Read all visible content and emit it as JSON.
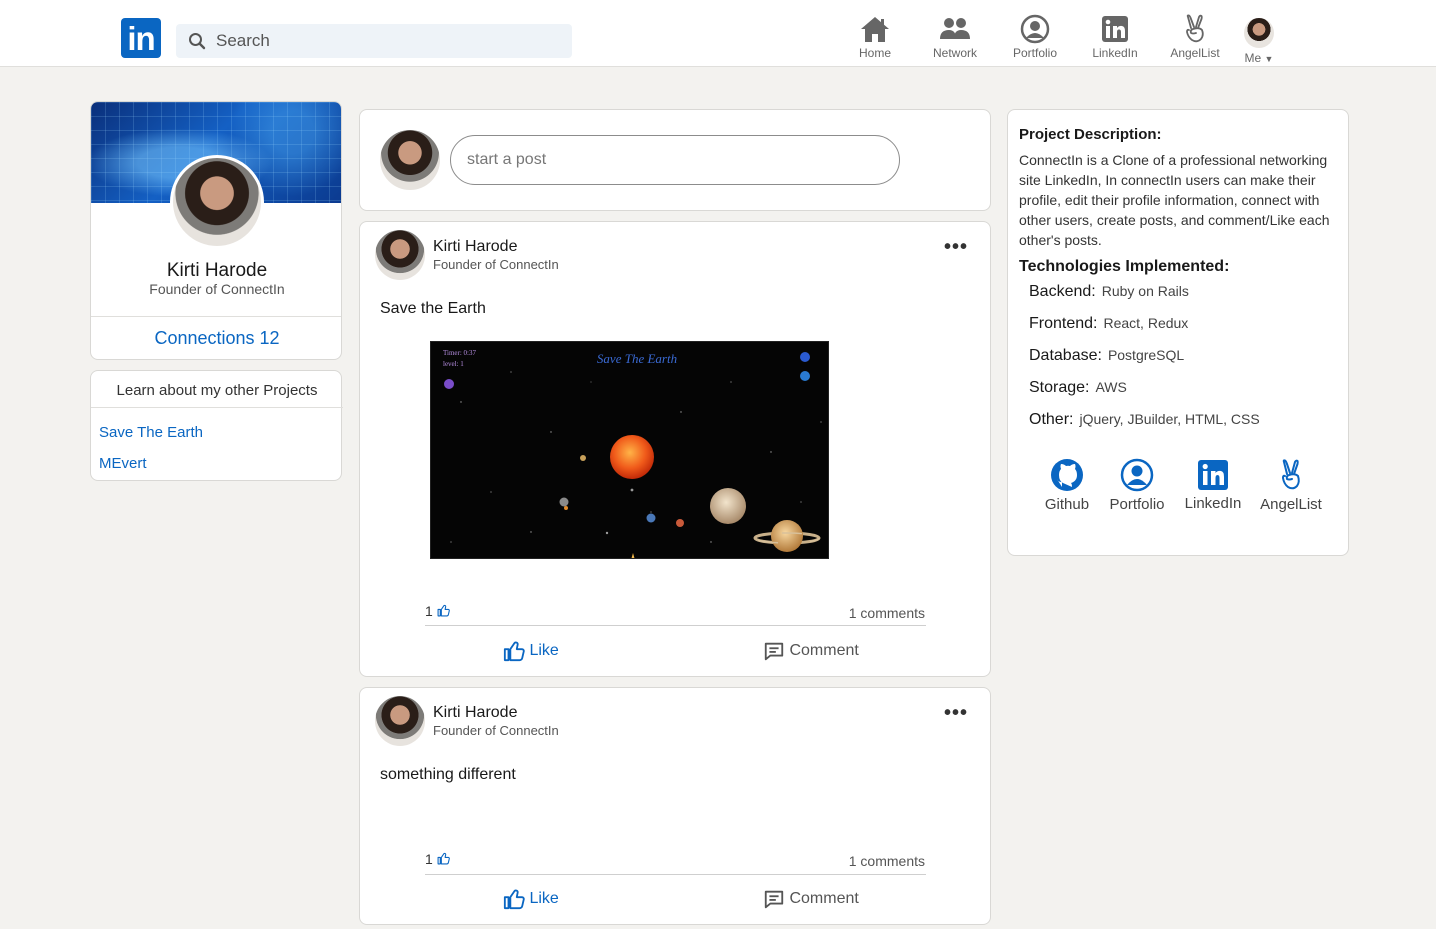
{
  "header": {
    "logo_text": "in",
    "search_placeholder": "Search",
    "nav": [
      {
        "label": "Home",
        "icon": "home-icon"
      },
      {
        "label": "Network",
        "icon": "network-icon"
      },
      {
        "label": "Portfolio",
        "icon": "portfolio-icon"
      },
      {
        "label": "LinkedIn",
        "icon": "linkedin-icon"
      },
      {
        "label": "AngelList",
        "icon": "angellist-icon"
      },
      {
        "label": "Me",
        "icon": "avatar"
      }
    ]
  },
  "profile": {
    "name": "Kirti Harode",
    "title": "Founder of ConnectIn",
    "connections": "Connections 12"
  },
  "projects": {
    "heading": "Learn about my other Projects",
    "links": [
      "Save The Earth",
      "MEvert"
    ]
  },
  "composer": {
    "placeholder": "start a post"
  },
  "posts": [
    {
      "author": "Kirti Harode",
      "title": "Founder of ConnectIn",
      "text": "Save the Earth",
      "likes": "1",
      "comments": "1 comments",
      "image": {
        "title": "Save The Earth",
        "timer": "Timer: 0:37",
        "level": "level: 1"
      }
    },
    {
      "author": "Kirti Harode",
      "title": "Founder of ConnectIn",
      "text": "something different",
      "likes": "1",
      "comments": "1 comments"
    }
  ],
  "actions": {
    "like": "Like",
    "comment": "Comment"
  },
  "about": {
    "desc_heading": "Project Description:",
    "description": "ConnectIn is a Clone of a professional networking site LinkedIn, In connectIn users can make their profile, edit their profile information, connect with other users, create posts, and comment/Like each other's posts.",
    "tech_heading": "Technologies Implemented:",
    "tech": [
      {
        "key": "Backend:",
        "value": "Ruby on Rails"
      },
      {
        "key": "Frontend:",
        "value": "React, Redux"
      },
      {
        "key": "Database:",
        "value": "PostgreSQL"
      },
      {
        "key": "Storage:",
        "value": "AWS"
      },
      {
        "key": "Other:",
        "value": "jQuery, JBuilder, HTML, CSS"
      }
    ],
    "links": [
      {
        "label": "Github",
        "icon": "github-icon"
      },
      {
        "label": "Portfolio",
        "icon": "portfolio-icon"
      },
      {
        "label": "LinkedIn",
        "icon": "linkedin-icon"
      },
      {
        "label": "AngelList",
        "icon": "angellist-icon"
      }
    ]
  },
  "colors": {
    "brand": "#0a66c2",
    "background": "#f3f2ef"
  }
}
